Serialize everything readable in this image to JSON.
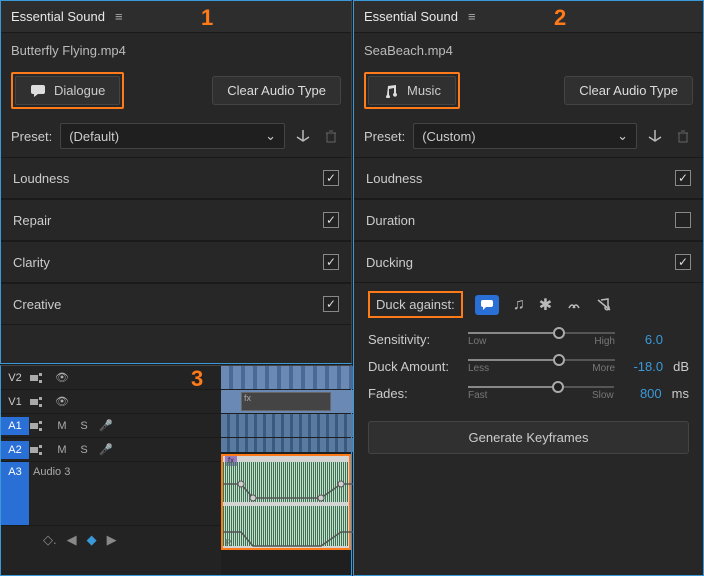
{
  "panel1": {
    "title": "Essential Sound",
    "callout": "1",
    "file": "Butterfly Flying.mp4",
    "audioType": "Dialogue",
    "clearBtn": "Clear Audio Type",
    "presetLabel": "Preset:",
    "presetValue": "(Default)",
    "sections": [
      {
        "label": "Loudness",
        "checked": true
      },
      {
        "label": "Repair",
        "checked": true
      },
      {
        "label": "Clarity",
        "checked": true
      },
      {
        "label": "Creative",
        "checked": true
      }
    ]
  },
  "panel2": {
    "title": "Essential Sound",
    "callout": "2",
    "file": "SeaBeach.mp4",
    "audioType": "Music",
    "clearBtn": "Clear Audio Type",
    "presetLabel": "Preset:",
    "presetValue": "(Custom)",
    "sections": [
      {
        "label": "Loudness",
        "checked": true
      },
      {
        "label": "Duration",
        "checked": false
      },
      {
        "label": "Ducking",
        "checked": true
      }
    ],
    "duckAgainst": "Duck against:",
    "sliders": [
      {
        "label": "Sensitivity:",
        "low": "Low",
        "high": "High",
        "value": "6.0",
        "unit": "",
        "pos": 62
      },
      {
        "label": "Duck Amount:",
        "low": "Less",
        "high": "More",
        "value": "-18.0",
        "unit": "dB",
        "pos": 62
      },
      {
        "label": "Fades:",
        "low": "Fast",
        "high": "Slow",
        "value": "800",
        "unit": "ms",
        "pos": 62
      }
    ],
    "generate": "Generate Keyframes"
  },
  "panel3": {
    "callout": "3",
    "tracks": {
      "v2": "V2",
      "v1": "V1",
      "a1": "A1",
      "a2": "A2",
      "a3": "A3",
      "a3name": "Audio 3"
    }
  }
}
